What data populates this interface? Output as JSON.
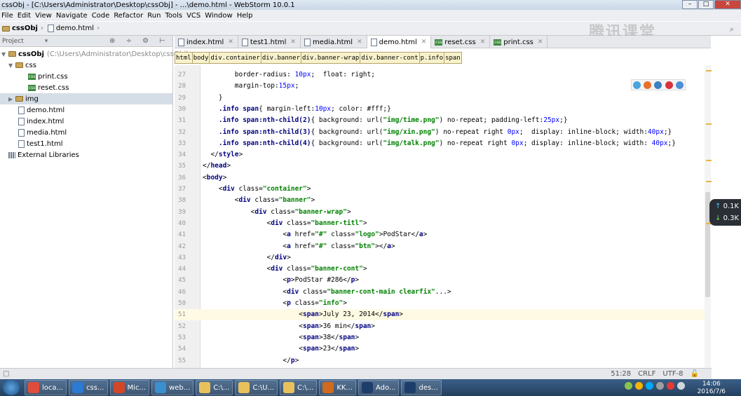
{
  "window": {
    "title": "cssObj - [C:\\Users\\Administrator\\Desktop\\cssObj] - ...\\demo.html - WebStorm 10.0.1"
  },
  "menu": [
    "File",
    "Edit",
    "View",
    "Navigate",
    "Code",
    "Refactor",
    "Run",
    "Tools",
    "VCS",
    "Window",
    "Help"
  ],
  "nav": {
    "project": "cssObj",
    "file": "demo.html",
    "watermark": "腾讯课堂"
  },
  "project": {
    "header": "Project",
    "root": "cssObj",
    "root_path": "(C:\\Users\\Administrator\\Desktop\\cssObj)",
    "css_folder": "css",
    "css_files": [
      "print.css",
      "reset.css"
    ],
    "img_folder": "img",
    "files": [
      "demo.html",
      "index.html",
      "media.html",
      "test1.html"
    ],
    "external": "External Libraries"
  },
  "tabs": [
    {
      "label": "index.html",
      "type": "html"
    },
    {
      "label": "test1.html",
      "type": "html"
    },
    {
      "label": "media.html",
      "type": "html"
    },
    {
      "label": "demo.html",
      "type": "html",
      "active": true
    },
    {
      "label": "reset.css",
      "type": "css"
    },
    {
      "label": "print.css",
      "type": "css"
    }
  ],
  "tag_path": [
    "html",
    "body",
    "div.container",
    "div.banner",
    "div.banner-wrap",
    "div.banner-cont",
    "p.info",
    "span"
  ],
  "code_lines": [
    {
      "n": "27",
      "text": "        border-radius: 10px;  float: right;"
    },
    {
      "n": "28",
      "text": "        margin-top:15px;"
    },
    {
      "n": "29",
      "text": "    }"
    },
    {
      "n": "30",
      "text": "    .info span{ margin-left:10px; color: #fff;}"
    },
    {
      "n": "31",
      "text": "    .info span:nth-child(2){ background: url(\"img/time.png\") no-repeat; padding-left:25px;}"
    },
    {
      "n": "32",
      "text": "    .info span:nth-child(3){ background: url(\"img/xin.png\") no-repeat right 0px;  display: inline-block; width:40px;}"
    },
    {
      "n": "33",
      "text": "    .info span:nth-child(4){ background: url(\"img/talk.png\") no-repeat right 0px; display: inline-block; width: 40px;}"
    },
    {
      "n": "34",
      "text": "  </style>"
    },
    {
      "n": "35",
      "text": "</head>"
    },
    {
      "n": "36",
      "text": "<body>"
    },
    {
      "n": "37",
      "text": "    <div class=\"container\">"
    },
    {
      "n": "38",
      "text": "        <div class=\"banner\">"
    },
    {
      "n": "39",
      "text": "            <div class=\"banner-wrap\">"
    },
    {
      "n": "40",
      "text": "                <div class=\"banner-titl\">"
    },
    {
      "n": "41",
      "text": "                    <a href=\"#\" class=\"logo\">PodStar</a>"
    },
    {
      "n": "42",
      "text": "                    <a href=\"#\" class=\"btn\"></a>"
    },
    {
      "n": "43",
      "text": "                </div>"
    },
    {
      "n": "44",
      "text": "                <div class=\"banner-cont\">"
    },
    {
      "n": "45",
      "text": "                    <p>PodStar #286</p>"
    },
    {
      "n": "46",
      "text": "                    <div class=\"banner-cont-main clearfix\"...>"
    },
    {
      "n": "50",
      "text": "                    <p class=\"info\">"
    },
    {
      "n": "51",
      "text": "                        <span>July 23, 2014</span>"
    },
    {
      "n": "52",
      "text": "                        <span>36 min</span>"
    },
    {
      "n": "53",
      "text": "                        <span>38</span>"
    },
    {
      "n": "54",
      "text": "                        <span>23</span>"
    },
    {
      "n": "55",
      "text": "                    </p>"
    }
  ],
  "status": {
    "position": "51:28",
    "line_sep": "CRLF",
    "encoding": "UTF-8"
  },
  "net": {
    "up": "0.1K",
    "down": "0.3K"
  },
  "taskbar": {
    "items": [
      {
        "label": "loca...",
        "color": "#e14b3b"
      },
      {
        "label": "css...",
        "color": "#2c7bd3"
      },
      {
        "label": "Mic...",
        "color": "#d24726"
      },
      {
        "label": "web...",
        "color": "#3a8fd0"
      },
      {
        "label": "C:\\...",
        "color": "#e8c15c"
      },
      {
        "label": "C:\\U...",
        "color": "#e8c15c"
      },
      {
        "label": "C:\\...",
        "color": "#e8c15c"
      },
      {
        "label": "KK...",
        "color": "#d06a1e"
      },
      {
        "label": "Ado...",
        "color": "#1d3e6b"
      },
      {
        "label": "des...",
        "color": "#1d3e6b"
      }
    ],
    "time": "14:06",
    "date": "2016/7/6"
  },
  "colors": {
    "accent": "#000080",
    "string": "#008000",
    "tab_active": "#ffffff"
  }
}
